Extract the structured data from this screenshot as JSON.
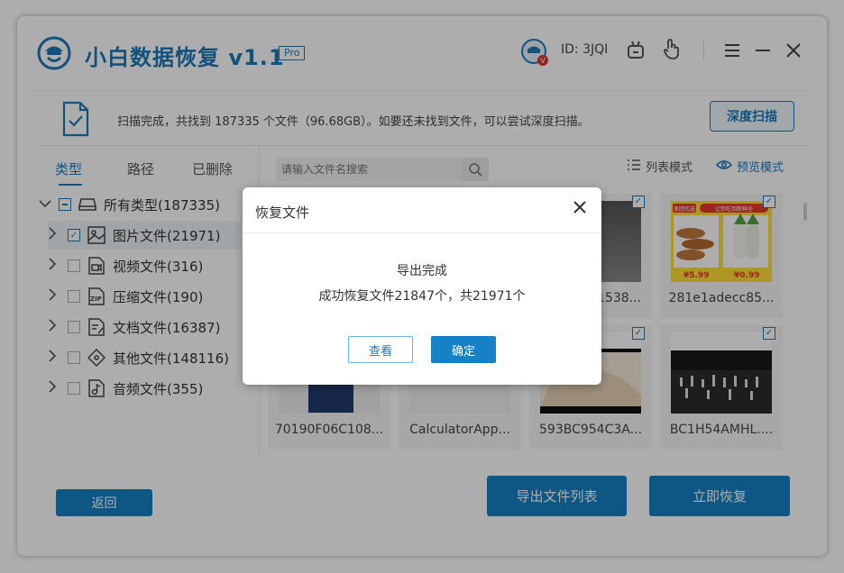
{
  "app": {
    "title": "小白数据恢复 v1.1",
    "pro_badge": "Pro",
    "user_id": "ID: 3JQI",
    "brand_color": "#1e7ab8"
  },
  "window_controls": [
    "menu-icon",
    "minimize-icon",
    "close-icon"
  ],
  "scan_bar": {
    "message": "扫描完成，共找到 187335 个文件（96.68GB）。如要还未找到文件，可以尝试深度扫描。",
    "deep_scan_label": "深度扫描"
  },
  "tabs": [
    {
      "label": "类型",
      "active": true
    },
    {
      "label": "路径",
      "active": false
    },
    {
      "label": "已删除",
      "active": false
    }
  ],
  "search": {
    "placeholder": "请输入文件名搜索"
  },
  "view_modes": {
    "list": "列表模式",
    "preview": "预览模式",
    "active": "preview"
  },
  "tree": {
    "root": "所有类型(187335)",
    "items": [
      {
        "label": "图片文件(21971)",
        "icon": "image-icon",
        "checked": true
      },
      {
        "label": "视频文件(316)",
        "icon": "video-icon",
        "checked": false
      },
      {
        "label": "压缩文件(190)",
        "icon": "zip-icon",
        "checked": false
      },
      {
        "label": "文档文件(16387)",
        "icon": "document-icon",
        "checked": false
      },
      {
        "label": "其他文件(148116)",
        "icon": "other-file-icon",
        "checked": false
      },
      {
        "label": "音频文件(355)",
        "icon": "audio-icon",
        "checked": false
      }
    ]
  },
  "thumbnails": [
    {
      "name": "",
      "row": 1
    },
    {
      "name": "",
      "row": 1
    },
    {
      "name": "1538...",
      "row": 1
    },
    {
      "name": "281e1adecc85...",
      "row": 1
    },
    {
      "name": "70190F06C108...",
      "row": 2
    },
    {
      "name": "CalculatorApp...",
      "row": 2
    },
    {
      "name": "593BC954C3A...",
      "row": 2
    },
    {
      "name": "BC1H54AMHL....",
      "row": 2
    }
  ],
  "thumb_text": {
    "price1": "¥5.99",
    "price2": "¥0.99",
    "tag1": "美团优选",
    "tag2": "让你吃到新鲜全"
  },
  "footer": {
    "back_label": "返回",
    "export_list_label": "导出文件列表",
    "recover_now_label": "立即恢复"
  },
  "dialog": {
    "title": "恢复文件",
    "message_line1": "导出完成",
    "message_line2": "成功恢复文件21847个，共21971个",
    "view_label": "查看",
    "ok_label": "确定"
  }
}
